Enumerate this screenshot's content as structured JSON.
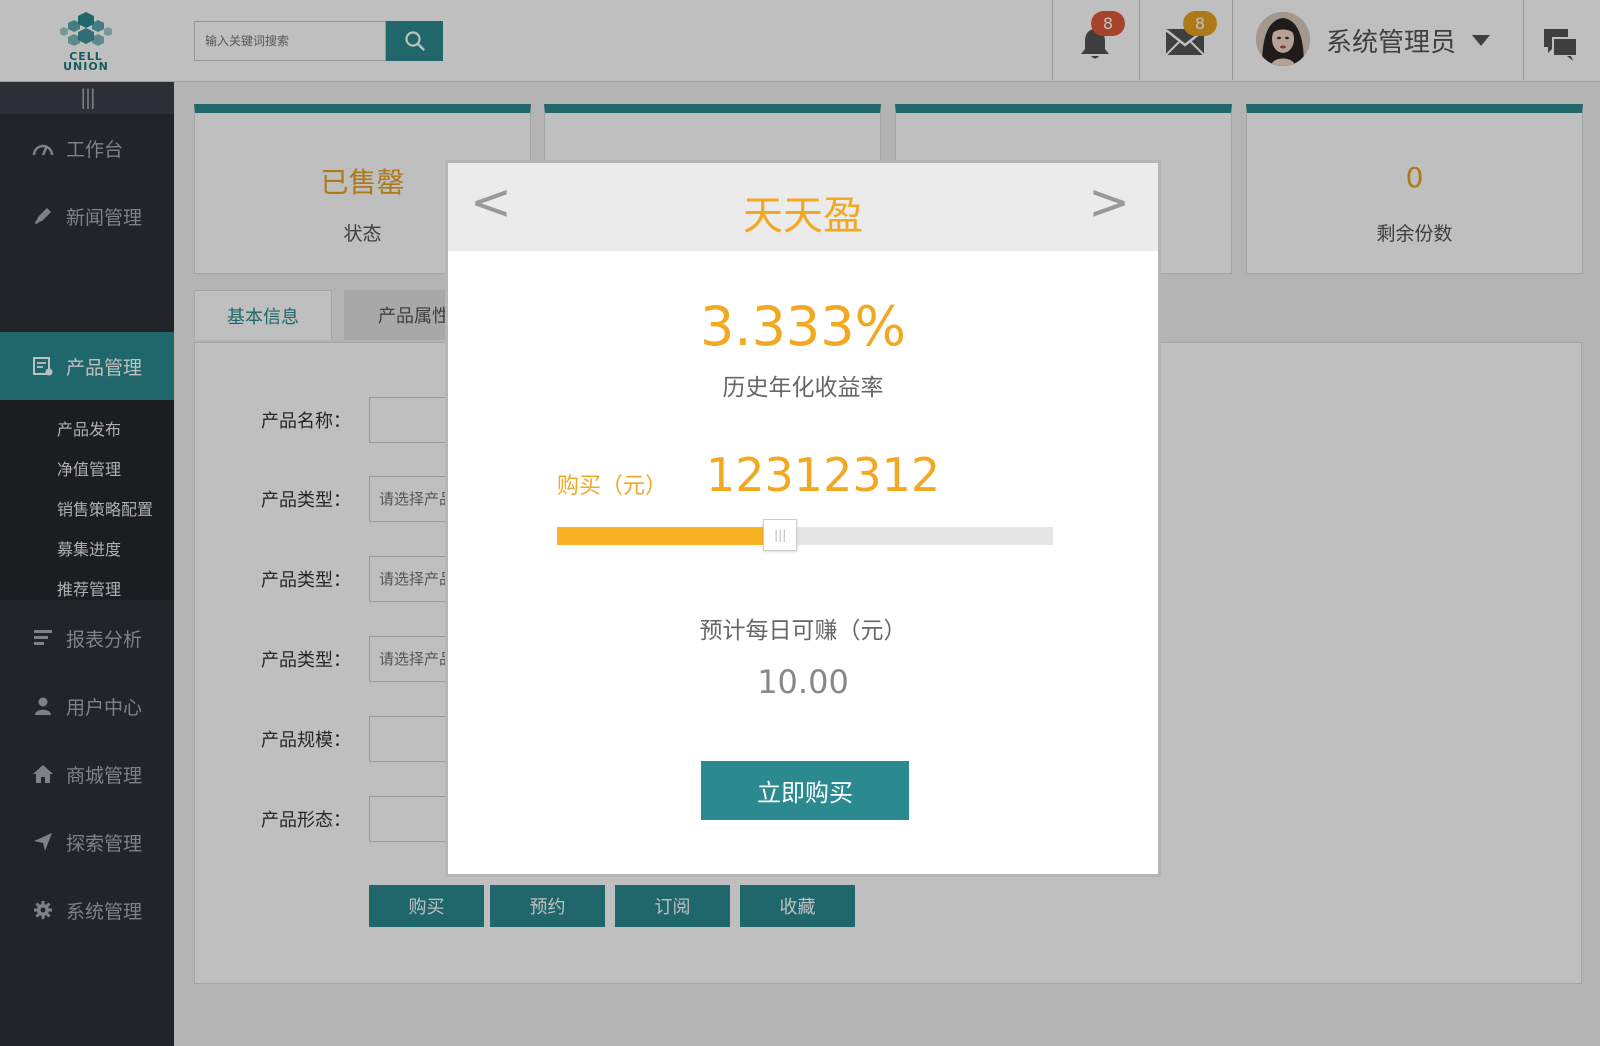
{
  "header": {
    "logo_text_1": "CELL",
    "logo_text_2": "UNION",
    "search_placeholder": "输入关键词搜索",
    "search_icon": "search-icon",
    "notifications_count": "8",
    "messages_count": "8",
    "username": "系统管理员",
    "colors": {
      "accent": "#2a8a8f",
      "badge_red": "#e05a3a",
      "badge_yellow": "#e8a21f"
    }
  },
  "sidebar": {
    "items": [
      {
        "label": "工作台",
        "icon": "dashboard-gauge-icon"
      },
      {
        "label": "新闻管理",
        "icon": "pencil-icon"
      },
      {
        "label": "产品管理",
        "icon": "product-list-icon"
      },
      {
        "label": "报表分析",
        "icon": "report-bars-icon"
      },
      {
        "label": "用户中心",
        "icon": "user-icon"
      },
      {
        "label": "商城管理",
        "icon": "home-icon"
      },
      {
        "label": "探索管理",
        "icon": "send-arrow-icon"
      },
      {
        "label": "系统管理",
        "icon": "gear-icon"
      }
    ],
    "sub_items": [
      "产品发布",
      "净值管理",
      "销售策略配置",
      "募集进度",
      "推荐管理"
    ]
  },
  "stats": [
    {
      "value": "已售罄",
      "label": "状态"
    },
    {
      "value": "",
      "label": ""
    },
    {
      "value": "",
      "label": ""
    },
    {
      "value": "0",
      "label": "剩余份数"
    }
  ],
  "tabs": [
    "基本信息",
    "产品属性"
  ],
  "form": {
    "labels": [
      "产品名称：",
      "产品类型：",
      "产品类型：",
      "产品类型：",
      "产品规模：",
      "产品形态："
    ],
    "select_placeholder": "请选择产品",
    "buttons": [
      "购买",
      "预约",
      "订阅",
      "收藏"
    ]
  },
  "modal": {
    "prev": "<",
    "next": ">",
    "title": "天天盈",
    "rate": "3.333%",
    "rate_label": "历史年化收益率",
    "buy_label": "购买（元）",
    "buy_amount": "12312312",
    "slider_level": 0.45,
    "earn_label": "预计每日可赚（元）",
    "earn_value": "10.00",
    "buy_button": "立即购买"
  }
}
